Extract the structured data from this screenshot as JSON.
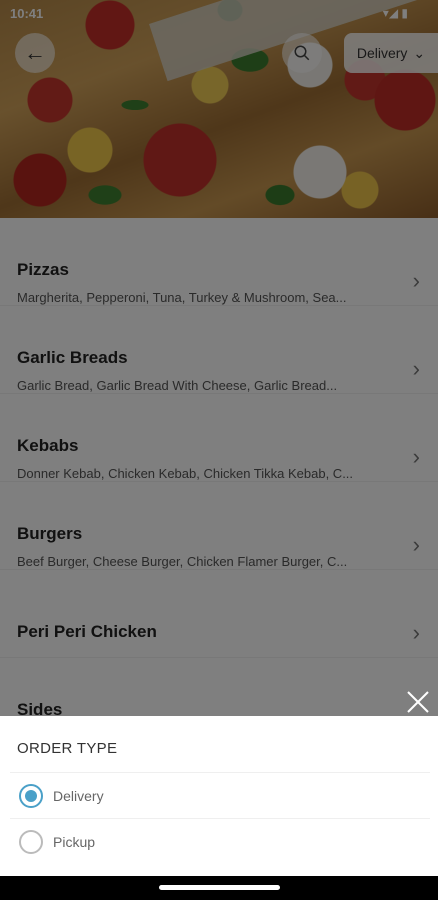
{
  "status_bar": {
    "time": "10:41",
    "icons": "▾◢ ▮"
  },
  "header": {
    "back_icon": "arrow-left-icon",
    "search_icon": "search-icon",
    "order_mode_label": "Delivery"
  },
  "categories": [
    {
      "title": "Pizzas",
      "desc": "Margherita, Pepperoni, Tuna, Turkey & Mushroom, Sea..."
    },
    {
      "title": "Garlic Breads",
      "desc": "Garlic Bread, Garlic Bread With Cheese, Garlic Bread..."
    },
    {
      "title": "Kebabs",
      "desc": "Donner Kebab, Chicken Kebab, Chicken Tikka Kebab, C..."
    },
    {
      "title": "Burgers",
      "desc": "Beef Burger, Cheese Burger, Chicken Flamer Burger, C..."
    },
    {
      "title": "Peri Peri Chicken",
      "desc": ""
    },
    {
      "title": "Sides",
      "desc": ""
    }
  ],
  "order_type_sheet": {
    "header": "ORDER TYPE",
    "options": [
      {
        "label": "Delivery",
        "selected": true
      },
      {
        "label": "Pickup",
        "selected": false
      }
    ]
  },
  "colors": {
    "accent": "#4aa0c8",
    "overlay": "rgba(0,0,0,0.5)"
  }
}
